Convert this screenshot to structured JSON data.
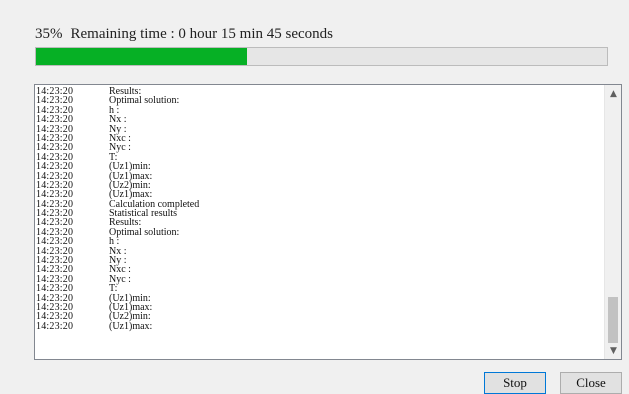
{
  "status": {
    "percent_label": "35%",
    "remaining_label": "Remaining time : 0 hour 15 min 45 seconds",
    "progress": 0.37
  },
  "log": {
    "rows": [
      {
        "time": "14:23:20",
        "msg": "Results:"
      },
      {
        "time": "14:23:20",
        "msg": "Optimal solution:"
      },
      {
        "time": "14:23:20",
        "msg": "h :"
      },
      {
        "time": "14:23:20",
        "msg": "Nx :"
      },
      {
        "time": "14:23:20",
        "msg": "Ny :"
      },
      {
        "time": "14:23:20",
        "msg": "Nxc :"
      },
      {
        "time": "14:23:20",
        "msg": "Nyc :"
      },
      {
        "time": "14:23:20",
        "msg": "T:"
      },
      {
        "time": "14:23:20",
        "msg": "(Uz1)min:"
      },
      {
        "time": "14:23:20",
        "msg": "(Uz1)max:"
      },
      {
        "time": "14:23:20",
        "msg": "(Uz2)min:"
      },
      {
        "time": "14:23:20",
        "msg": "(Uz1)max:"
      },
      {
        "time": "14:23:20",
        "msg": "Calculation completed"
      },
      {
        "time": "14:23:20",
        "msg": "Statistical results"
      },
      {
        "time": "14:23:20",
        "msg": "Results:"
      },
      {
        "time": "14:23:20",
        "msg": "Optimal solution:"
      },
      {
        "time": "14:23:20",
        "msg": "h :"
      },
      {
        "time": "14:23:20",
        "msg": "Nx :"
      },
      {
        "time": "14:23:20",
        "msg": "Ny :"
      },
      {
        "time": "14:23:20",
        "msg": "Nxc :"
      },
      {
        "time": "14:23:20",
        "msg": "Nyc :"
      },
      {
        "time": "14:23:20",
        "msg": "T:"
      },
      {
        "time": "14:23:20",
        "msg": "(Uz1)min:"
      },
      {
        "time": "14:23:20",
        "msg": "(Uz1)max:"
      },
      {
        "time": "14:23:20",
        "msg": "(Uz2)min:"
      },
      {
        "time": "14:23:20",
        "msg": "(Uz1)max:"
      }
    ]
  },
  "buttons": {
    "stop_label": "Stop",
    "close_label": "Close"
  },
  "scrollbar": {
    "up_icon": "chevron-up-icon",
    "down_icon": "chevron-down-icon"
  },
  "colors": {
    "progress_fill": "#06b025",
    "stop_border": "#0078d7"
  }
}
